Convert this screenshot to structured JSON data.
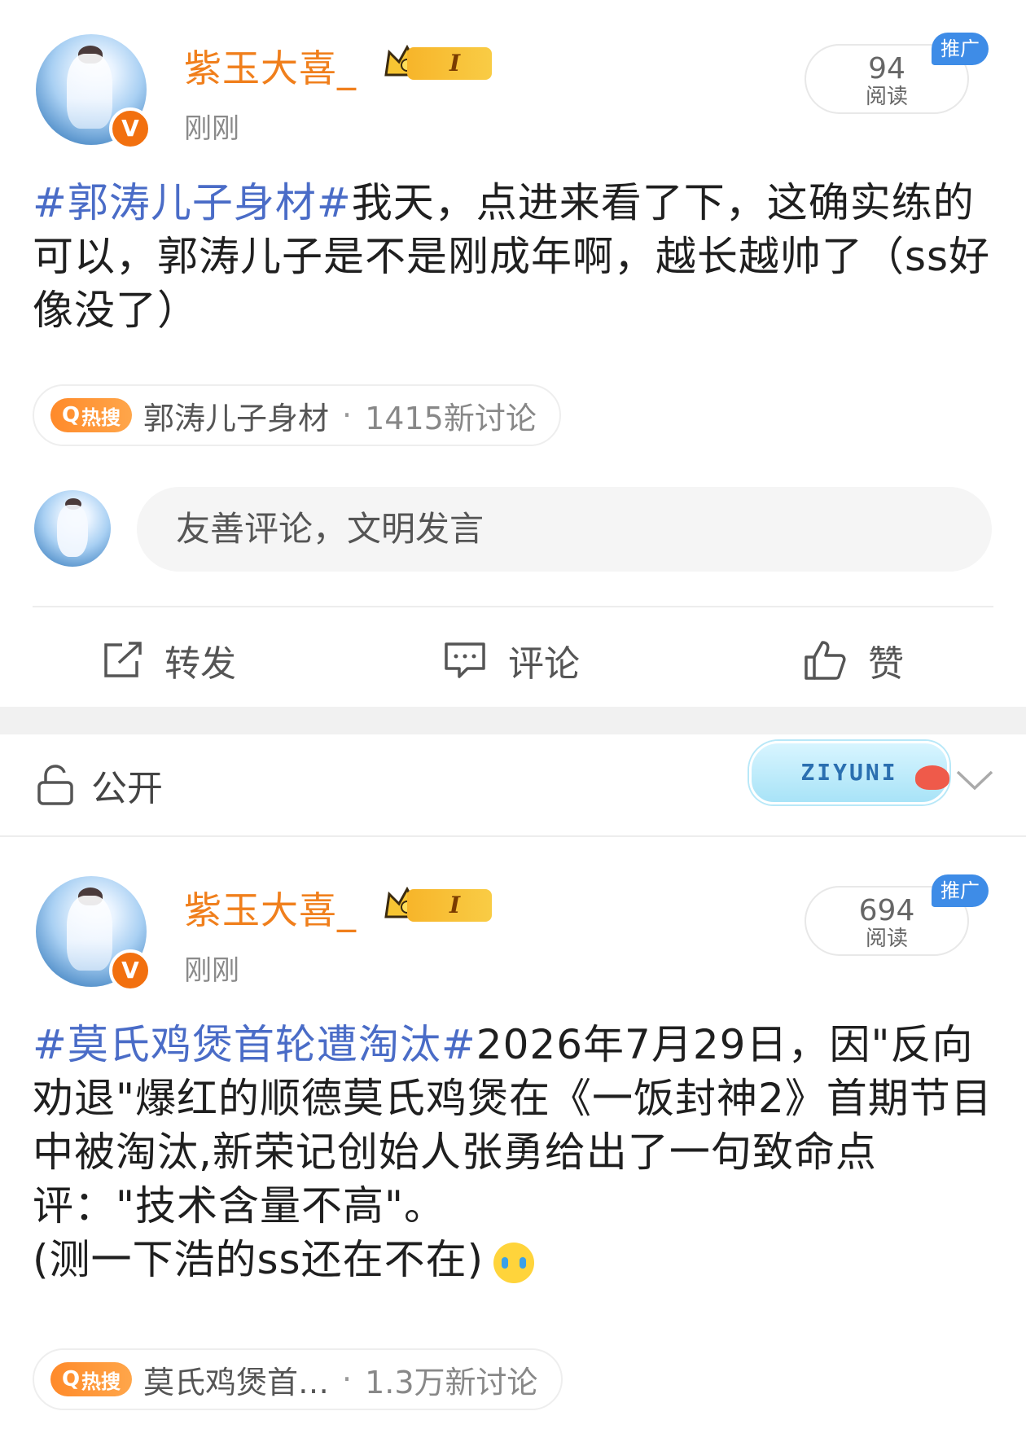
{
  "post1": {
    "username": "紫玉大喜_",
    "vip_level": "I",
    "time": "刚刚",
    "verified_mark": "V",
    "reads": "94",
    "reads_label": "阅读",
    "promo": "推广",
    "hashtag": "#郭涛儿子身材#",
    "body": "我天，点进来看了下，这确实练的可以，郭涛儿子是不是刚成年啊，越长越帅了（ss好像没了）",
    "hot_badge": "热搜",
    "hot_topic": "郭涛儿子身材",
    "hot_separator": "·",
    "hot_count": "1415新讨论",
    "comment_placeholder": "友善评论，文明发言",
    "actions": {
      "repost": "转发",
      "comment": "评论",
      "like": "赞"
    }
  },
  "visibility": {
    "label": "公开",
    "decoration_text": "ZIYUNI"
  },
  "post2": {
    "username": "紫玉大喜_",
    "vip_level": "I",
    "time": "刚刚",
    "verified_mark": "V",
    "reads": "694",
    "reads_label": "阅读",
    "promo": "推广",
    "hashtag": "#莫氏鸡煲首轮遭淘汰#",
    "body_line1": "2026年7月29日，因\"反向劝退\"爆红的顺德莫氏鸡煲在《一饭封神2》首期节目中被淘汰,新荣记创始人张勇给出了一句致命点评：\"技术含量不高\"。",
    "body_line2": "(测一下浩的ss还在不在)",
    "emoji": "crying-emoji",
    "hot_badge": "热搜",
    "hot_topic": "莫氏鸡煲首…",
    "hot_separator": "·",
    "hot_count": "1.3万新讨论"
  },
  "colors": {
    "username": "#f07f1c",
    "hashtag": "#4a6cc7",
    "hot_badge": "#ff8a2a",
    "promo": "#3e8ce7"
  }
}
